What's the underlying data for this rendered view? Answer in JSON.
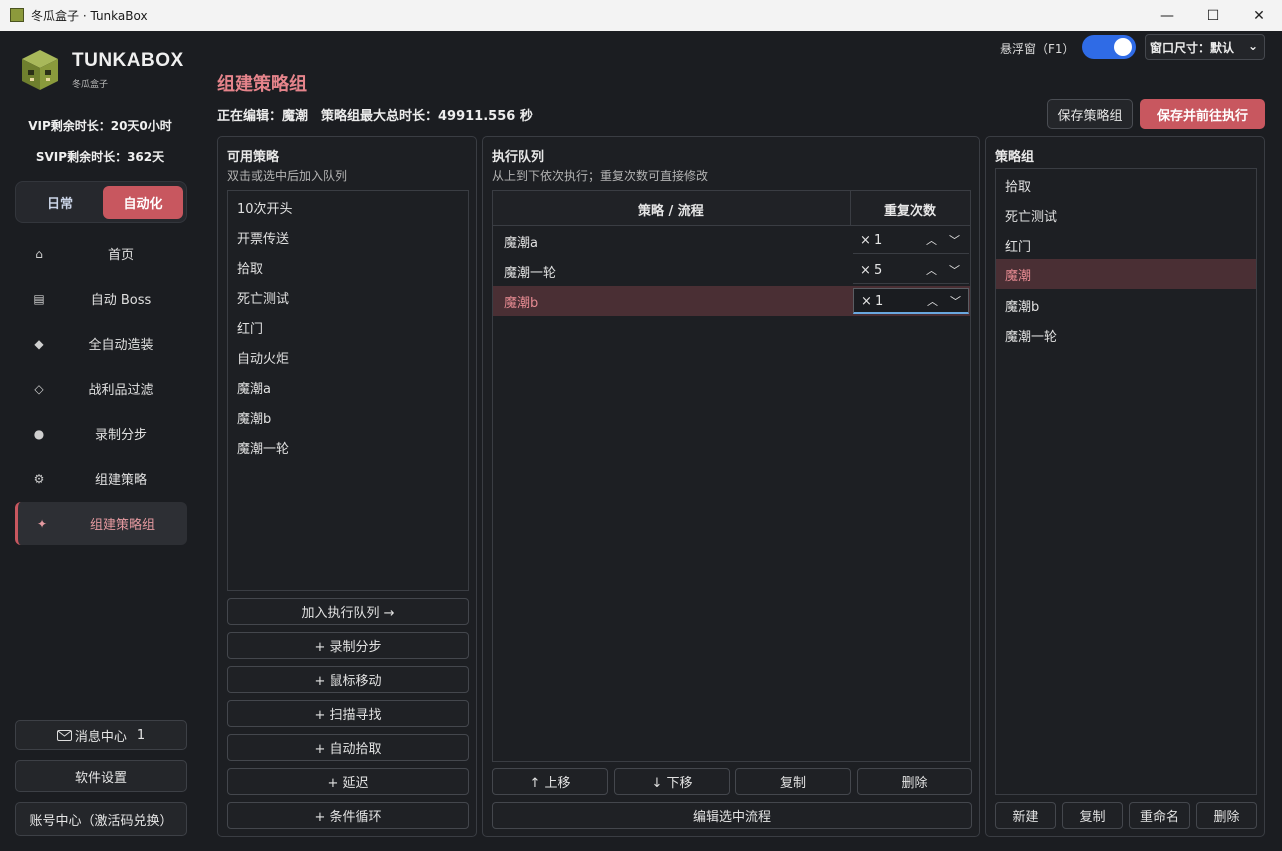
{
  "window": {
    "title": "冬瓜盒子 · TunkaBox",
    "minimize": "—",
    "maximize": "☐",
    "close": "✕"
  },
  "brand": {
    "name": "TUNKABOX",
    "sub": "冬瓜盒子"
  },
  "vip": {
    "vip_line": "VIP剩余时长：20天0小时",
    "svip_line": "SVIP剩余时长：362天"
  },
  "mode": {
    "daily": "日常",
    "auto": "自动化"
  },
  "nav": [
    {
      "icon": "⌂",
      "label": "首页"
    },
    {
      "icon": "▤",
      "label": "自动 Boss"
    },
    {
      "icon": "◆",
      "label": "全自动造装"
    },
    {
      "icon": "◇",
      "label": "战利品过滤"
    },
    {
      "icon": "●",
      "label": "录制分步"
    },
    {
      "icon": "⚙",
      "label": "组建策略"
    },
    {
      "icon": "✦",
      "label": "组建策略组"
    }
  ],
  "sidebar_bottom": {
    "messages": "消息中心",
    "message_count": "1",
    "settings": "软件设置",
    "account": "账号中心（激活码兑换）"
  },
  "header": {
    "title": "组建策略组",
    "editing": "正在编辑：魔潮　策略组最大总时长：49911.556 秒",
    "float_label": "悬浮窗（F1）",
    "float_enabled": true,
    "window_size": "窗口尺寸：默认",
    "save_btn": "保存策略组",
    "save_run_btn": "保存并前往执行"
  },
  "available": {
    "title": "可用策略",
    "subtitle": "双击或选中后加入队列",
    "items": [
      "10次开头",
      "开票传送",
      "拾取",
      "死亡测试",
      "红门",
      "自动火炬",
      "魔潮a",
      "魔潮b",
      "魔潮一轮"
    ],
    "buttons": [
      "加入执行队列 →",
      "+ 录制分步",
      "+ 鼠标移动",
      "+ 扫描寻找",
      "+ 自动拾取",
      "+ 延迟",
      "+ 条件循环"
    ]
  },
  "queue": {
    "title": "执行队列",
    "subtitle": "从上到下依次执行；重复次数可直接修改",
    "col_name": "策略 / 流程",
    "col_repeat": "重复次数",
    "rows": [
      {
        "name": "魔潮a",
        "times": "1"
      },
      {
        "name": "魔潮一轮",
        "times": "5"
      },
      {
        "name": "魔潮b",
        "times": "1"
      }
    ],
    "buttons": [
      "↑ 上移",
      "↓ 下移",
      "复制",
      "删除"
    ],
    "edit_btn": "编辑选中流程"
  },
  "groups": {
    "title": "策略组",
    "items": [
      "拾取",
      "死亡测试",
      "红门",
      "魔潮",
      "魔潮b",
      "魔潮一轮"
    ],
    "selected_index": 3,
    "buttons": [
      "新建",
      "复制",
      "重命名",
      "删除"
    ]
  },
  "colors": {
    "accent": "#c8575f",
    "accent_text": "#e5848b",
    "toggle": "#2f6be6",
    "bg": "#1b1d21"
  }
}
